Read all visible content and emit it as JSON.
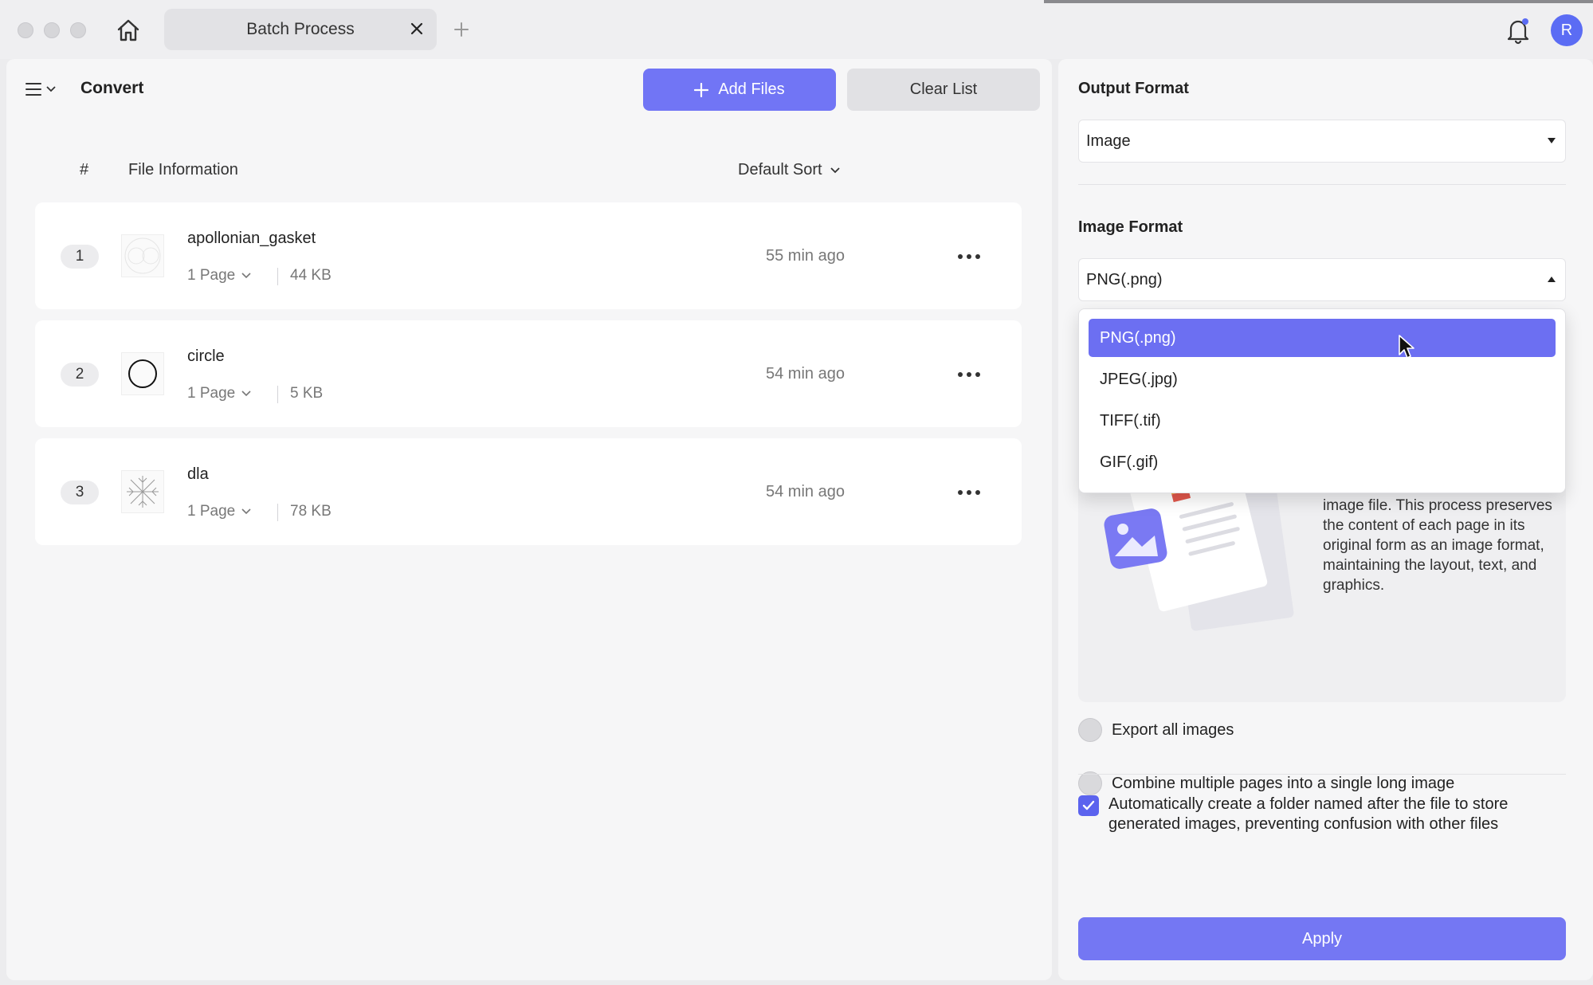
{
  "titlebar": {
    "tab_title": "Batch Process",
    "avatar_initial": "R"
  },
  "left": {
    "title": "Convert",
    "add_files_label": "Add Files",
    "clear_list_label": "Clear List",
    "columns": {
      "number": "#",
      "file_info": "File Information",
      "sort": "Default Sort"
    },
    "files": [
      {
        "index": "1",
        "name": "apollonian_gasket",
        "pages": "1 Page",
        "size": "44 KB",
        "time": "55 min ago"
      },
      {
        "index": "2",
        "name": "circle",
        "pages": "1 Page",
        "size": "5 KB",
        "time": "54 min ago"
      },
      {
        "index": "3",
        "name": "dla",
        "pages": "1 Page",
        "size": "78 KB",
        "time": "54 min ago"
      }
    ]
  },
  "right": {
    "output_format_label": "Output Format",
    "output_format_value": "Image",
    "image_format_label": "Image Format",
    "image_format_value": "PNG(.png)",
    "dropdown_options": [
      "PNG(.png)",
      "JPEG(.jpg)",
      "TIFF(.tif)",
      "GIF(.gif)"
    ],
    "info_text": "image file. This process preserves the content of each page in its original form as an image format, maintaining the layout, text, and graphics.",
    "export_all_label": "Export all images",
    "combine_label": "Combine multiple pages into a single long image",
    "auto_folder_label": "Automatically create a folder named after the file to store generated images, preventing confusion with other files",
    "apply_label": "Apply"
  },
  "colors": {
    "accent": "#7175f5",
    "selected_option": "#6c6ff2",
    "checkbox": "#5b63ee",
    "avatar": "#5b6cf4"
  }
}
